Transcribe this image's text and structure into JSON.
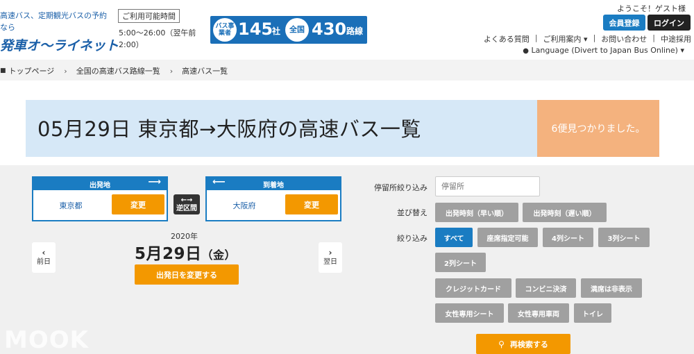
{
  "header": {
    "tagline": "高速バス、定期観光バスの予約なら",
    "logo": "発車オ〜ライネット",
    "hours_label": "ご利用可能時間",
    "hours_text": "5:00〜26:00（翌午前2:00）",
    "stats": {
      "operators_badge": "バス事業者",
      "operators_num": "145",
      "operators_unit": "社",
      "routes_badge": "全国",
      "routes_num": "430",
      "routes_unit": "路線"
    },
    "welcome": "ようこそ！ゲスト様",
    "register_label": "会員登録",
    "login_label": "ログイン",
    "nav": [
      "よくある質問",
      "ご利用案内 ▾",
      "お問い合わせ",
      "中途採用"
    ],
    "language": "Language (Divert to Japan Bus Online) ▾"
  },
  "breadcrumb": [
    "トップページ",
    "全国の高速バス路線一覧",
    "高速バス一覧"
  ],
  "banner": {
    "title": "05月29日 東京都→大阪府の高速バス一覧",
    "found": "6便見つかりました。"
  },
  "search": {
    "departure": {
      "label": "出発地",
      "place": "東京都",
      "change": "変更"
    },
    "arrival": {
      "label": "到着地",
      "place": "大阪府",
      "change": "変更"
    },
    "swap_label": "逆区間",
    "year": "2020年",
    "date_main": "5月29日",
    "date_dow": "（金）",
    "change_date": "出発日を変更する",
    "prev_day": "前日",
    "next_day": "翌日"
  },
  "filters": {
    "stop_label": "停留所絞り込み",
    "stop_placeholder": "停留所",
    "sort_label": "並び替え",
    "sort_options": [
      "出発時刻（早い順）",
      "出発時刻（遅い順）"
    ],
    "narrow_label": "絞り込み",
    "narrow_options": [
      "すべて",
      "座席指定可能",
      "4列シート",
      "3列シート",
      "2列シート",
      "クレジットカード",
      "コンビニ決済",
      "満席は非表示",
      "女性専用シート",
      "女性専用車両",
      "トイレ"
    ],
    "research_label": "再検索する"
  },
  "watermark": "MOOK",
  "colors": {
    "brand_blue": "#1a7cc2",
    "accent_orange": "#f39800",
    "found_bg": "#f4b27e",
    "banner_bg": "#d6e8f7"
  }
}
